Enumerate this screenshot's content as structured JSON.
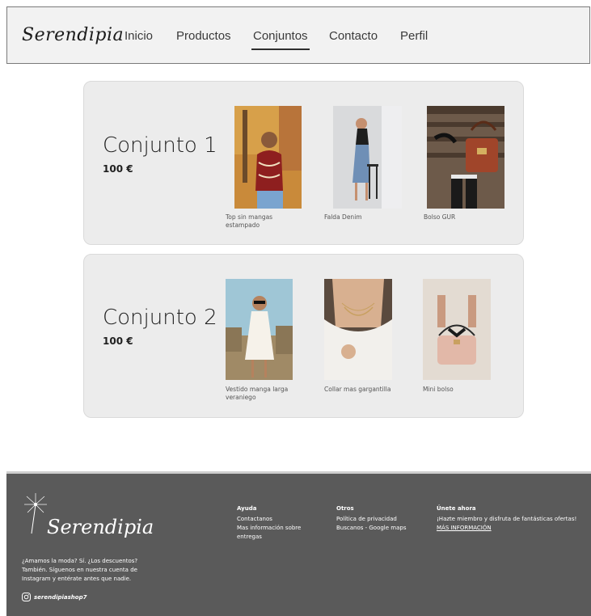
{
  "nav": {
    "logo": "Serendipia",
    "items": [
      {
        "label": "Inicio",
        "active": false
      },
      {
        "label": "Productos",
        "active": false
      },
      {
        "label": "Conjuntos",
        "active": true
      },
      {
        "label": "Contacto",
        "active": false
      },
      {
        "label": "Perfil",
        "active": false
      }
    ]
  },
  "outfits": [
    {
      "title": "Conjunto 1",
      "price": "100 €",
      "products": [
        {
          "name": "Top sin mangas estampado"
        },
        {
          "name": "Falda Denim"
        },
        {
          "name": "Bolso GUR"
        }
      ]
    },
    {
      "title": "Conjunto 2",
      "price": "100 €",
      "products": [
        {
          "name": "Vestido manga larga veraniego"
        },
        {
          "name": "Collar mas gargantilla"
        },
        {
          "name": "Mini bolso"
        }
      ]
    }
  ],
  "footer": {
    "logo": "Serendipia",
    "tagline": "¿Amamos la moda? Sí. ¿Los descuentos? También. Síguenos en nuestra cuenta de Instagram  y entérate antes que nadie.",
    "instagram_handle": "serendipiashop7",
    "columns": {
      "ayuda": {
        "heading": "Ayuda",
        "links": [
          "Contactanos",
          "Mas información sobre entregas"
        ]
      },
      "otros": {
        "heading": "Otros",
        "links": [
          "Política de privacidad",
          "Buscanos - Google maps"
        ]
      },
      "unete": {
        "heading": "Únete ahora",
        "text": "¡Hazte miembro y disfruta de fantásticas ofertas!",
        "link": "MÁS INFORMACIÓN"
      }
    }
  },
  "colors": {
    "nav_bg": "#f2f2f2",
    "card_bg": "#ececec",
    "footer_bg": "#5a5a5a"
  }
}
